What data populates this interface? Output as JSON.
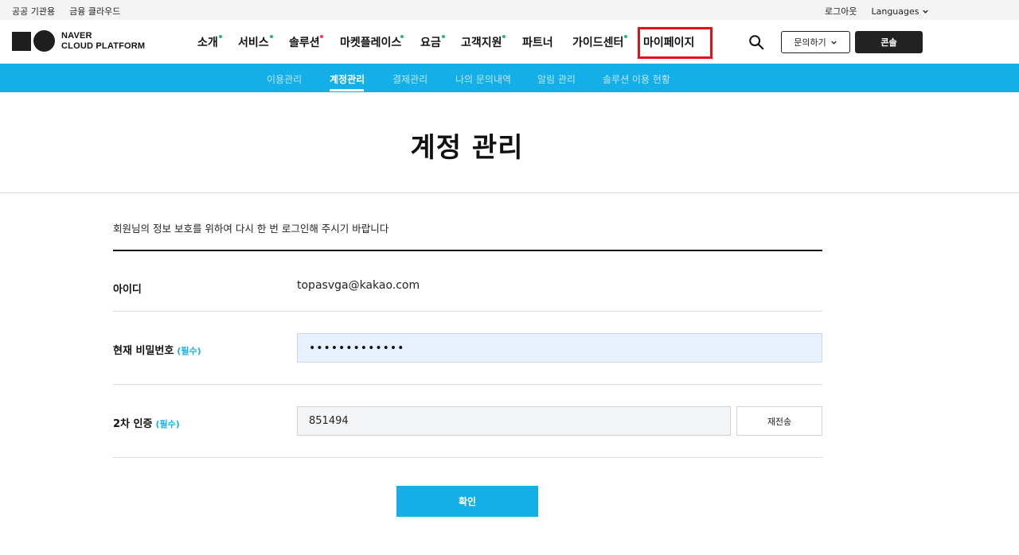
{
  "utility": {
    "left_links": [
      "공공 기관용",
      "금융 클라우드"
    ],
    "logout": "로그아웃",
    "languages": "Languages"
  },
  "logo": {
    "line1": "NAVER",
    "line2": "CLOUD PLATFORM"
  },
  "gnb": {
    "items": [
      {
        "label": "소개",
        "dot": "green"
      },
      {
        "label": "서비스",
        "dot": "green"
      },
      {
        "label": "솔루션",
        "dot": "red"
      },
      {
        "label": "마켓플레이스",
        "dot": "green"
      },
      {
        "label": "요금",
        "dot": "green"
      },
      {
        "label": "고객지원",
        "dot": "green"
      },
      {
        "label": "파트너",
        "dot": ""
      },
      {
        "label": "가이드센터",
        "dot": "green"
      },
      {
        "label": "마이페이지",
        "dot": ""
      }
    ],
    "inquiry": "문의하기",
    "console": "콘솔"
  },
  "subnav": {
    "items": [
      "이용관리",
      "계정관리",
      "결제관리",
      "나의 문의내역",
      "알림 관리",
      "솔루션 이용 현황"
    ],
    "active": "계정관리"
  },
  "page": {
    "title": "계정 관리",
    "notice": "회원님의 정보 보호를 위하여 다시 한 번 로그인해 주시기 바랍니다"
  },
  "form": {
    "id_label": "아이디",
    "id_value": "topasvga@kakao.com",
    "pw_label": "현재 비밀번호",
    "required": "(필수)",
    "pw_value": "•••••••••••••",
    "otp_label": "2차 인증",
    "otp_value": "851494",
    "resend": "재전송",
    "confirm": "확인"
  },
  "colors": {
    "accent": "#14aee8",
    "highlight": "#e01218",
    "green_dot": "#16c36b",
    "red_dot": "#ff3b4b"
  }
}
